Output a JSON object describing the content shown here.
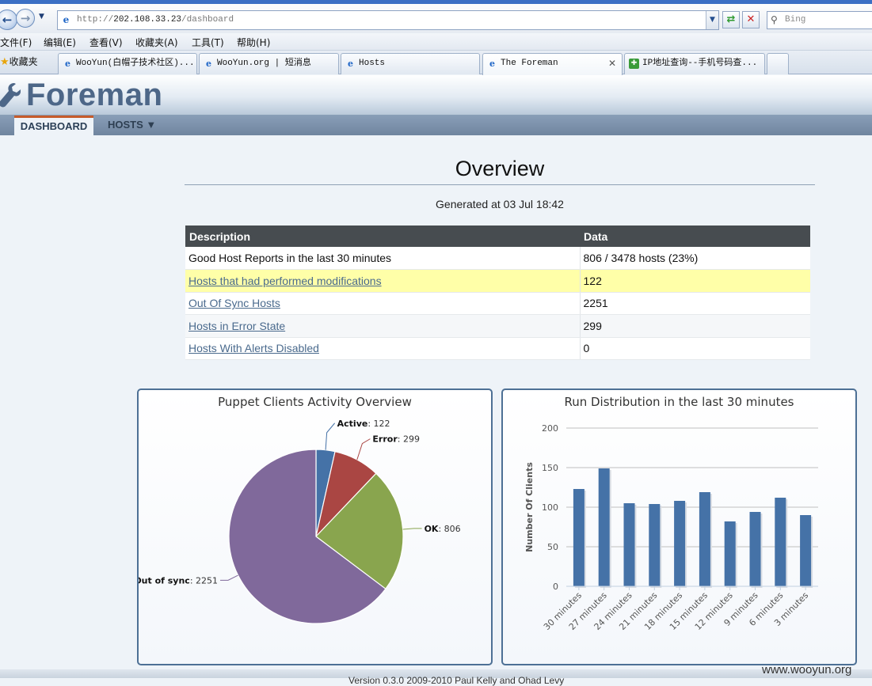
{
  "browser": {
    "url_scheme": "http://",
    "url_host": "202.108.33.23",
    "url_path": "/dashboard",
    "search_placeholder": "Bing",
    "menu": [
      "文件(F)",
      "编辑(E)",
      "查看(V)",
      "收藏夹(A)",
      "工具(T)",
      "帮助(H)"
    ],
    "favorites_label": "收藏夹",
    "tabs": [
      {
        "label": "WooYun(白帽子技术社区)...",
        "icon": "ie-icon"
      },
      {
        "label": "WooYun.org | 短消息",
        "icon": "ie-icon"
      },
      {
        "label": "Hosts",
        "icon": "ie-icon"
      },
      {
        "label": "The Foreman",
        "icon": "ie-icon",
        "active": true
      },
      {
        "label": "IP地址查询--手机号码查...",
        "icon": "ip-icon"
      }
    ]
  },
  "app": {
    "title": "Foreman",
    "nav": {
      "dashboard": "DASHBOARD",
      "hosts": "HOSTS ▼"
    }
  },
  "overview": {
    "title": "Overview",
    "generated": "Generated at 03 Jul 18:42",
    "headers": {
      "description": "Description",
      "data": "Data"
    },
    "rows": [
      {
        "description": "Good Host Reports in the last 30 minutes",
        "data": "806 / 3478 hosts (23%)",
        "link": false
      },
      {
        "description": "Hosts that had performed modifications",
        "data": "122",
        "link": true
      },
      {
        "description": "Out Of Sync Hosts",
        "data": "2251",
        "link": true
      },
      {
        "description": "Hosts in Error State",
        "data": "299",
        "link": true
      },
      {
        "description": "Hosts With Alerts Disabled",
        "data": "0",
        "link": true
      }
    ]
  },
  "chart_data": [
    {
      "type": "pie",
      "title": "Puppet Clients Activity Overview",
      "slices": [
        {
          "name": "Active",
          "value": 122,
          "color": "#4572a7"
        },
        {
          "name": "Error",
          "value": 299,
          "color": "#aa4643"
        },
        {
          "name": "OK",
          "value": 806,
          "color": "#89a54e"
        },
        {
          "name": "Out of sync",
          "value": 2251,
          "color": "#80699b"
        }
      ]
    },
    {
      "type": "bar",
      "title": "Run Distribution in the last 30 minutes",
      "ylabel": "Number Of Clients",
      "categories": [
        "30 minutes",
        "27 minutes",
        "24 minutes",
        "21 minutes",
        "18 minutes",
        "15 minutes",
        "12 minutes",
        "9 minutes",
        "6 minutes",
        "3 minutes"
      ],
      "values": [
        123,
        149,
        105,
        104,
        108,
        119,
        82,
        94,
        112,
        90
      ],
      "ylim": [
        0,
        200
      ],
      "yticks": [
        0,
        50,
        100,
        150,
        200
      ],
      "color": "#4572a7",
      "grid": true
    }
  ],
  "footer": "Version 0.3.0 2009-2010 Paul Kelly and Ohad Levy",
  "watermark": "www.wooyun.org"
}
